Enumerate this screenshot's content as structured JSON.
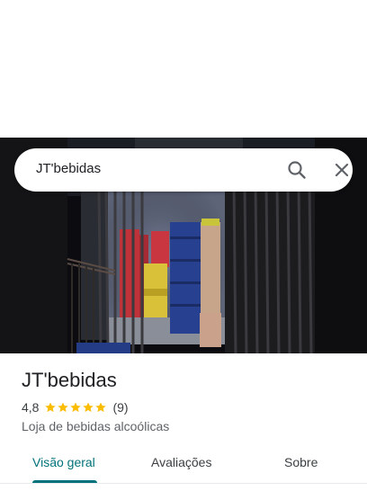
{
  "search": {
    "query": "JT'bebidas"
  },
  "place": {
    "name": "JT'bebidas",
    "rating": "4,8",
    "rating_stars": 5,
    "review_count": "(9)",
    "category": "Loja de bebidas alcoólicas"
  },
  "tabs": [
    {
      "label": "Visão geral",
      "active": true
    },
    {
      "label": "Avaliações",
      "active": false
    },
    {
      "label": "Sobre",
      "active": false
    }
  ],
  "colors": {
    "accent": "#00737a",
    "star": "#fbbc04",
    "text_primary": "#202124",
    "text_secondary": "#5f6368"
  },
  "icons": {
    "search": "search-icon",
    "close": "close-icon",
    "star": "star-icon"
  }
}
